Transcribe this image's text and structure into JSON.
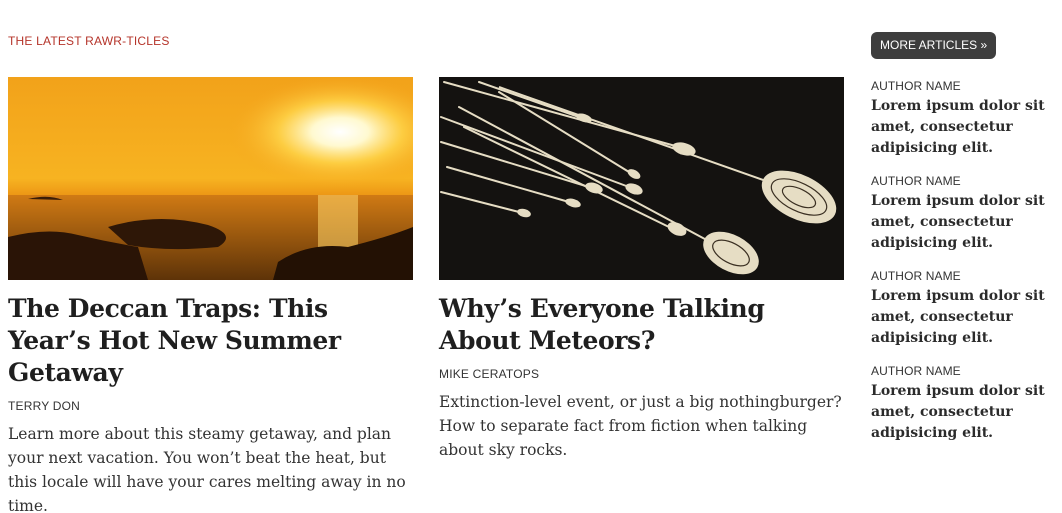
{
  "section": {
    "label": "THE LATEST RAWR-TICLES"
  },
  "more_button": {
    "label": "MORE ARTICLES »"
  },
  "articles": [
    {
      "title": "The Deccan Traps: This Year’s Hot New Summer Getaway",
      "author": "TERRY DON",
      "description": "Learn more about this steamy getaway, and plan your next vacation. You won’t beat the heat, but this locale will have your cares melting away in no time."
    },
    {
      "title": "Why’s Everyone Talking About Meteors?",
      "author": "MIKE CERATOPS",
      "description": "Extinction-level event, or just a big nothingburger? How to separate fact from fiction when talking about sky rocks."
    }
  ],
  "sidebar": {
    "items": [
      {
        "author": "AUTHOR NAME",
        "title": "Lorem ipsum dolor sit amet, consectetur adipisicing elit."
      },
      {
        "author": "AUTHOR NAME",
        "title": "Lorem ipsum dolor sit amet, consectetur adipisicing elit."
      },
      {
        "author": "AUTHOR NAME",
        "title": "Lorem ipsum dolor sit amet, consectetur adipisicing elit."
      },
      {
        "author": "AUTHOR NAME",
        "title": "Lorem ipsum dolor sit amet, consectetur adipisicing elit."
      }
    ]
  },
  "colors": {
    "accent": "#b5342a",
    "button": "#3e3e3e"
  }
}
